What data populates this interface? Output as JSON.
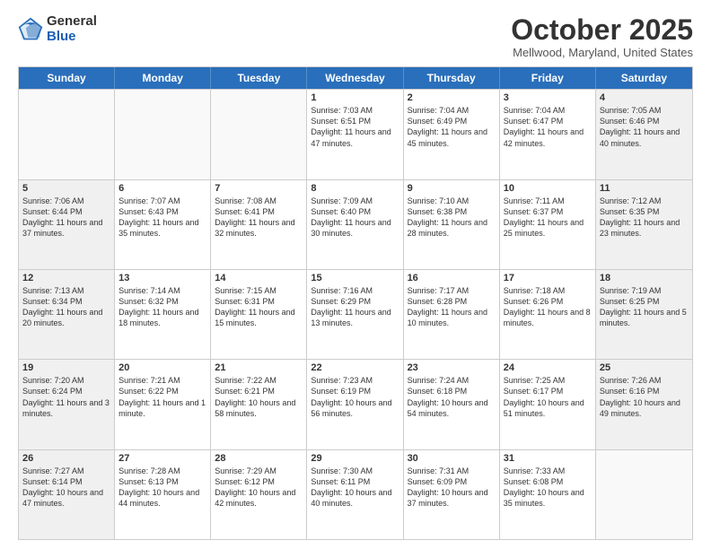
{
  "logo": {
    "general": "General",
    "blue": "Blue"
  },
  "title": "October 2025",
  "subtitle": "Mellwood, Maryland, United States",
  "days_of_week": [
    "Sunday",
    "Monday",
    "Tuesday",
    "Wednesday",
    "Thursday",
    "Friday",
    "Saturday"
  ],
  "weeks": [
    [
      {
        "day": "",
        "info": "",
        "empty": true
      },
      {
        "day": "",
        "info": "",
        "empty": true
      },
      {
        "day": "",
        "info": "",
        "empty": true
      },
      {
        "day": "1",
        "info": "Sunrise: 7:03 AM\nSunset: 6:51 PM\nDaylight: 11 hours and 47 minutes."
      },
      {
        "day": "2",
        "info": "Sunrise: 7:04 AM\nSunset: 6:49 PM\nDaylight: 11 hours and 45 minutes."
      },
      {
        "day": "3",
        "info": "Sunrise: 7:04 AM\nSunset: 6:47 PM\nDaylight: 11 hours and 42 minutes."
      },
      {
        "day": "4",
        "info": "Sunrise: 7:05 AM\nSunset: 6:46 PM\nDaylight: 11 hours and 40 minutes."
      }
    ],
    [
      {
        "day": "5",
        "info": "Sunrise: 7:06 AM\nSunset: 6:44 PM\nDaylight: 11 hours and 37 minutes."
      },
      {
        "day": "6",
        "info": "Sunrise: 7:07 AM\nSunset: 6:43 PM\nDaylight: 11 hours and 35 minutes."
      },
      {
        "day": "7",
        "info": "Sunrise: 7:08 AM\nSunset: 6:41 PM\nDaylight: 11 hours and 32 minutes."
      },
      {
        "day": "8",
        "info": "Sunrise: 7:09 AM\nSunset: 6:40 PM\nDaylight: 11 hours and 30 minutes."
      },
      {
        "day": "9",
        "info": "Sunrise: 7:10 AM\nSunset: 6:38 PM\nDaylight: 11 hours and 28 minutes."
      },
      {
        "day": "10",
        "info": "Sunrise: 7:11 AM\nSunset: 6:37 PM\nDaylight: 11 hours and 25 minutes."
      },
      {
        "day": "11",
        "info": "Sunrise: 7:12 AM\nSunset: 6:35 PM\nDaylight: 11 hours and 23 minutes."
      }
    ],
    [
      {
        "day": "12",
        "info": "Sunrise: 7:13 AM\nSunset: 6:34 PM\nDaylight: 11 hours and 20 minutes."
      },
      {
        "day": "13",
        "info": "Sunrise: 7:14 AM\nSunset: 6:32 PM\nDaylight: 11 hours and 18 minutes."
      },
      {
        "day": "14",
        "info": "Sunrise: 7:15 AM\nSunset: 6:31 PM\nDaylight: 11 hours and 15 minutes."
      },
      {
        "day": "15",
        "info": "Sunrise: 7:16 AM\nSunset: 6:29 PM\nDaylight: 11 hours and 13 minutes."
      },
      {
        "day": "16",
        "info": "Sunrise: 7:17 AM\nSunset: 6:28 PM\nDaylight: 11 hours and 10 minutes."
      },
      {
        "day": "17",
        "info": "Sunrise: 7:18 AM\nSunset: 6:26 PM\nDaylight: 11 hours and 8 minutes."
      },
      {
        "day": "18",
        "info": "Sunrise: 7:19 AM\nSunset: 6:25 PM\nDaylight: 11 hours and 5 minutes."
      }
    ],
    [
      {
        "day": "19",
        "info": "Sunrise: 7:20 AM\nSunset: 6:24 PM\nDaylight: 11 hours and 3 minutes."
      },
      {
        "day": "20",
        "info": "Sunrise: 7:21 AM\nSunset: 6:22 PM\nDaylight: 11 hours and 1 minute."
      },
      {
        "day": "21",
        "info": "Sunrise: 7:22 AM\nSunset: 6:21 PM\nDaylight: 10 hours and 58 minutes."
      },
      {
        "day": "22",
        "info": "Sunrise: 7:23 AM\nSunset: 6:19 PM\nDaylight: 10 hours and 56 minutes."
      },
      {
        "day": "23",
        "info": "Sunrise: 7:24 AM\nSunset: 6:18 PM\nDaylight: 10 hours and 54 minutes."
      },
      {
        "day": "24",
        "info": "Sunrise: 7:25 AM\nSunset: 6:17 PM\nDaylight: 10 hours and 51 minutes."
      },
      {
        "day": "25",
        "info": "Sunrise: 7:26 AM\nSunset: 6:16 PM\nDaylight: 10 hours and 49 minutes."
      }
    ],
    [
      {
        "day": "26",
        "info": "Sunrise: 7:27 AM\nSunset: 6:14 PM\nDaylight: 10 hours and 47 minutes."
      },
      {
        "day": "27",
        "info": "Sunrise: 7:28 AM\nSunset: 6:13 PM\nDaylight: 10 hours and 44 minutes."
      },
      {
        "day": "28",
        "info": "Sunrise: 7:29 AM\nSunset: 6:12 PM\nDaylight: 10 hours and 42 minutes."
      },
      {
        "day": "29",
        "info": "Sunrise: 7:30 AM\nSunset: 6:11 PM\nDaylight: 10 hours and 40 minutes."
      },
      {
        "day": "30",
        "info": "Sunrise: 7:31 AM\nSunset: 6:09 PM\nDaylight: 10 hours and 37 minutes."
      },
      {
        "day": "31",
        "info": "Sunrise: 7:33 AM\nSunset: 6:08 PM\nDaylight: 10 hours and 35 minutes."
      },
      {
        "day": "",
        "info": "",
        "empty": true
      }
    ]
  ]
}
